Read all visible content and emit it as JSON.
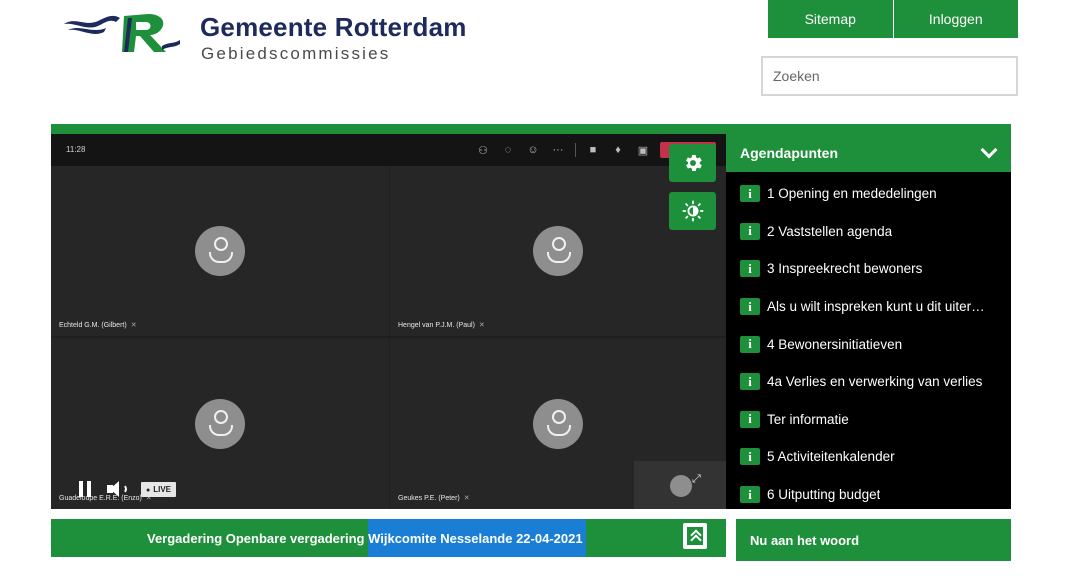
{
  "header": {
    "brand_title": "Gemeente Rotterdam",
    "brand_subtitle": "Gebiedscommissies",
    "nav": {
      "sitemap_label": "Sitemap",
      "login_label": "Inloggen"
    },
    "search": {
      "placeholder": "Zoeken"
    }
  },
  "video": {
    "time": "11:28",
    "toolbar_icons": [
      "participants-icon",
      "chat-icon",
      "reactions-icon",
      "more-icon",
      "camera-off-icon",
      "mic-off-icon",
      "share-icon",
      "leave-button"
    ],
    "participants": [
      {
        "name": "Echteld G.M. (Gilbert)"
      },
      {
        "name": "Hengel van P.J.M. (Paul)"
      },
      {
        "name": "Guadeloupe E.R.E. (Enzo)"
      },
      {
        "name": "Geukes P.E. (Peter)"
      }
    ],
    "live_label": "LIVE",
    "leave_color": "#c4314b"
  },
  "agenda": {
    "title": "Agendapunten",
    "items": [
      {
        "label": "1 Opening en mededelingen"
      },
      {
        "label": "2 Vaststellen agenda"
      },
      {
        "label": "3 Inspreekrecht bewoners"
      },
      {
        "label": "Als u wilt inspreken kunt u dit uiterl…"
      },
      {
        "label": "4 Bewonersinitiatieven"
      },
      {
        "label": "4a Verlies en verwerking van verlies"
      },
      {
        "label": "Ter informatie"
      },
      {
        "label": "5 Activiteitenkalender"
      },
      {
        "label": "6 Uitputting budget"
      }
    ],
    "info_glyph": "i"
  },
  "meeting": {
    "title_part1": "Vergadering Openbare vergadering ",
    "title_part2": "Wijkcomite Nesselande 22-04-2021"
  },
  "now_speaking": {
    "label": "Nu aan het woord"
  },
  "colors": {
    "accent_green": "#1e8f3a",
    "navy": "#1d2a5b",
    "highlight_blue": "#1a7fd4"
  }
}
